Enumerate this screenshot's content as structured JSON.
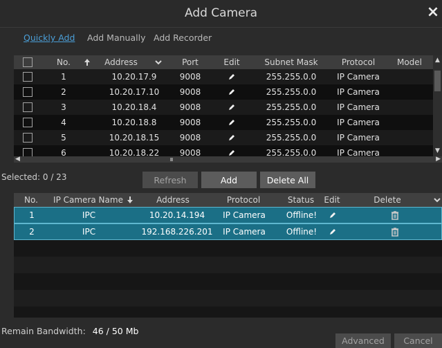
{
  "window": {
    "title": "Add Camera",
    "close_icon": "close-icon"
  },
  "tabs": [
    "Quickly Add",
    "Add Manually",
    "Add Recorder"
  ],
  "discovered": {
    "headers": [
      "No.",
      "Address",
      "Port",
      "Edit",
      "Subnet Mask",
      "Protocol",
      "Model"
    ],
    "rows": [
      {
        "no": "1",
        "address": "10.20.17.9",
        "port": "9008",
        "subnet": "255.255.0.0",
        "protocol": "IP Camera",
        "model": ""
      },
      {
        "no": "2",
        "address": "10.20.17.10",
        "port": "9008",
        "subnet": "255.255.0.0",
        "protocol": "IP Camera",
        "model": ""
      },
      {
        "no": "3",
        "address": "10.20.18.4",
        "port": "9008",
        "subnet": "255.255.0.0",
        "protocol": "IP Camera",
        "model": ""
      },
      {
        "no": "4",
        "address": "10.20.18.8",
        "port": "9008",
        "subnet": "255.255.0.0",
        "protocol": "IP Camera",
        "model": ""
      },
      {
        "no": "5",
        "address": "10.20.18.15",
        "port": "9008",
        "subnet": "255.255.0.0",
        "protocol": "IP Camera",
        "model": ""
      },
      {
        "no": "6",
        "address": "10.20.18.22",
        "port": "9008",
        "subnet": "255.255.0.0",
        "protocol": "IP Camera",
        "model": ""
      }
    ]
  },
  "selection": {
    "text": "Selected: 0 / 23"
  },
  "buttons": {
    "refresh": "Refresh",
    "add": "Add",
    "delete_all": "Delete All",
    "advanced": "Advanced",
    "cancel": "Cancel"
  },
  "added": {
    "headers": [
      "No.",
      "IP Camera Name",
      "Address",
      "Protocol",
      "Status",
      "Edit",
      "Delete"
    ],
    "rows": [
      {
        "no": "1",
        "name": "IPC",
        "address": "10.20.14.194",
        "protocol": "IP Camera",
        "status": "Offline!"
      },
      {
        "no": "2",
        "name": "IPC",
        "address": "192.168.226.201",
        "protocol": "IP Camera",
        "status": "Offline!"
      }
    ]
  },
  "bandwidth": {
    "label": "Remain Bandwidth:",
    "value": "46 / 50 Mb"
  },
  "icons": {
    "edit": "pencil-icon",
    "delete": "trash-icon",
    "sort_up": "arrow-up-icon",
    "sort_down": "arrow-down-icon",
    "dropdown": "chevron-down-icon"
  }
}
